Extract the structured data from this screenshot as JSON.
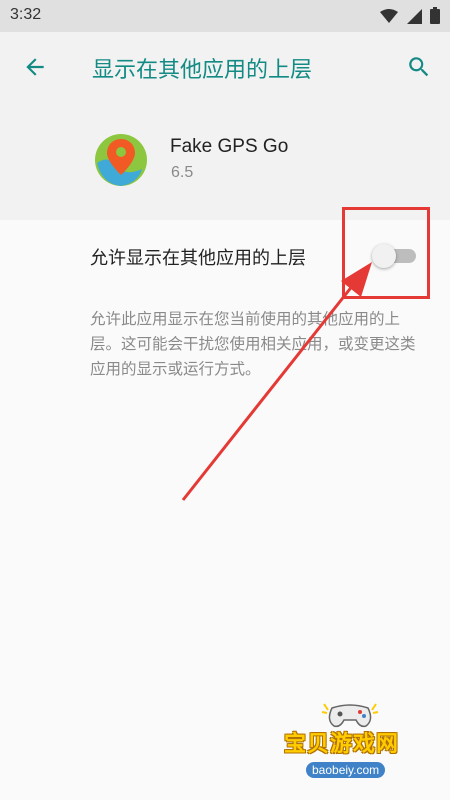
{
  "status_bar": {
    "time": "3:32",
    "icons": [
      "wifi-icon",
      "cellular-icon",
      "battery-icon"
    ]
  },
  "toolbar": {
    "title": "显示在其他应用的上层",
    "back_icon": "arrow-left-icon",
    "search_icon": "search-icon"
  },
  "app": {
    "name": "Fake GPS Go",
    "version": "6.5",
    "icon": "map-pin-icon"
  },
  "preference": {
    "title": "允许显示在其他应用的上层",
    "enabled": false,
    "summary": "允许此应用显示在您当前使用的其他应用的上层。这可能会干扰您使用相关应用，或变更这类应用的显示或运行方式。"
  },
  "watermark": {
    "title": "宝贝游戏网",
    "url": "baobeiy.com"
  },
  "colors": {
    "accent": "#138a84",
    "annotation": "#e53935"
  }
}
